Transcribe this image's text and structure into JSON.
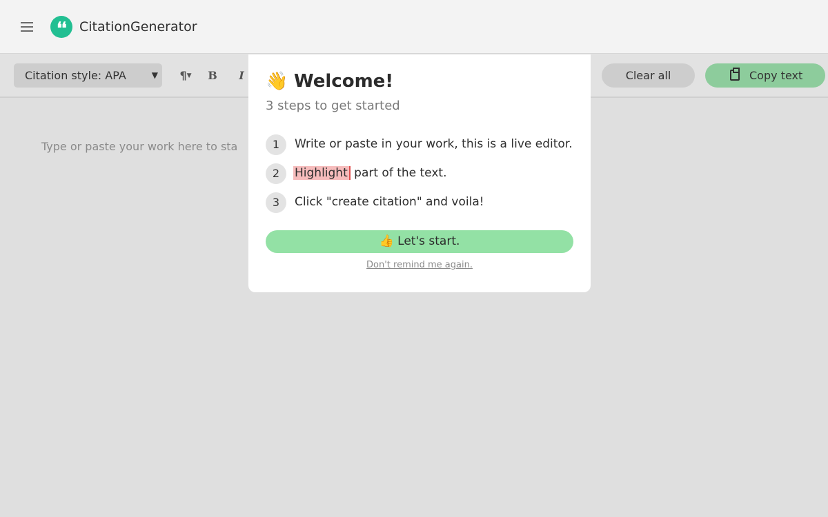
{
  "header": {
    "brand": "CitationGenerator",
    "logo_glyph": "❛❛"
  },
  "toolbar": {
    "citation_style": "Citation style: APA",
    "paragraph_glyph": "¶",
    "bold_glyph": "B",
    "italic_glyph": "I",
    "clear_label": "Clear all",
    "copy_label": "Copy text"
  },
  "editor": {
    "placeholder": "Type or paste your work here to sta"
  },
  "modal": {
    "wave_emoji": "👋",
    "title": "Welcome!",
    "subtitle": "3 steps to get started",
    "steps": [
      {
        "num": "1",
        "text": "Write or paste in your work, this is a live editor."
      },
      {
        "num": "2",
        "highlight": "Highlight",
        "text": "part of the text."
      },
      {
        "num": "3",
        "text": "Click \"create citation\" and voila!"
      }
    ],
    "start_emoji": "👍",
    "start_label": "Let's start.",
    "dont_remind": "Don't remind me again."
  },
  "colors": {
    "accent": "#22bf92",
    "copy_button": "#8dcc9c",
    "start_button": "#93e1a5",
    "highlight": "#f6bcbc"
  }
}
